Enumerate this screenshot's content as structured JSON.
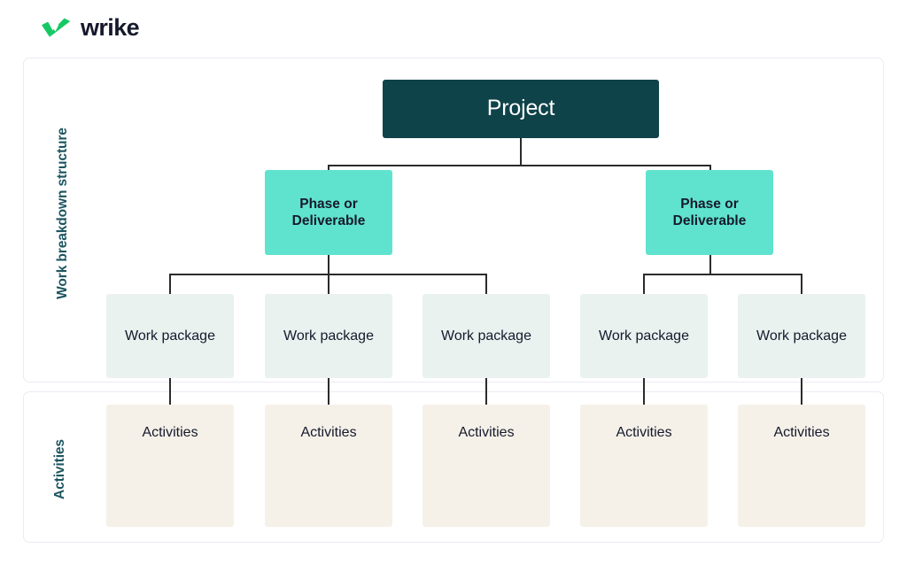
{
  "brand": {
    "name": "wrike",
    "logo_icon": "wrike-double-check-icon",
    "logo_color": "#14c864",
    "wordmark_color": "#16192c"
  },
  "sections": [
    {
      "id": "wbs",
      "label": "Work breakdown structure"
    },
    {
      "id": "activities",
      "label": "Activities"
    }
  ],
  "diagram": {
    "type": "work-breakdown-structure-tree",
    "colors": {
      "project": "#0e4349",
      "project_text": "#ffffff",
      "phase": "#5fe3cf",
      "work_package": "#e9f2ef",
      "activities": "#f5f1e9",
      "connector": "#2b2b2b",
      "panel_border": "#ecebf3",
      "side_label": "#1b5560"
    },
    "levels": {
      "level1_label": "Project",
      "level2_label": "Phase or Deliverable",
      "level3_label": "Work package",
      "level4_label": "Activities"
    },
    "project": {
      "label": "Project"
    },
    "phases": [
      {
        "label": "Phase or Deliverable",
        "children": 3
      },
      {
        "label": "Phase or Deliverable",
        "children": 2
      }
    ],
    "work_packages": [
      {
        "label": "Work package"
      },
      {
        "label": "Work package"
      },
      {
        "label": "Work package"
      },
      {
        "label": "Work package"
      },
      {
        "label": "Work package"
      }
    ],
    "activities": [
      {
        "label": "Activities"
      },
      {
        "label": "Activities"
      },
      {
        "label": "Activities"
      },
      {
        "label": "Activities"
      },
      {
        "label": "Activities"
      }
    ]
  }
}
